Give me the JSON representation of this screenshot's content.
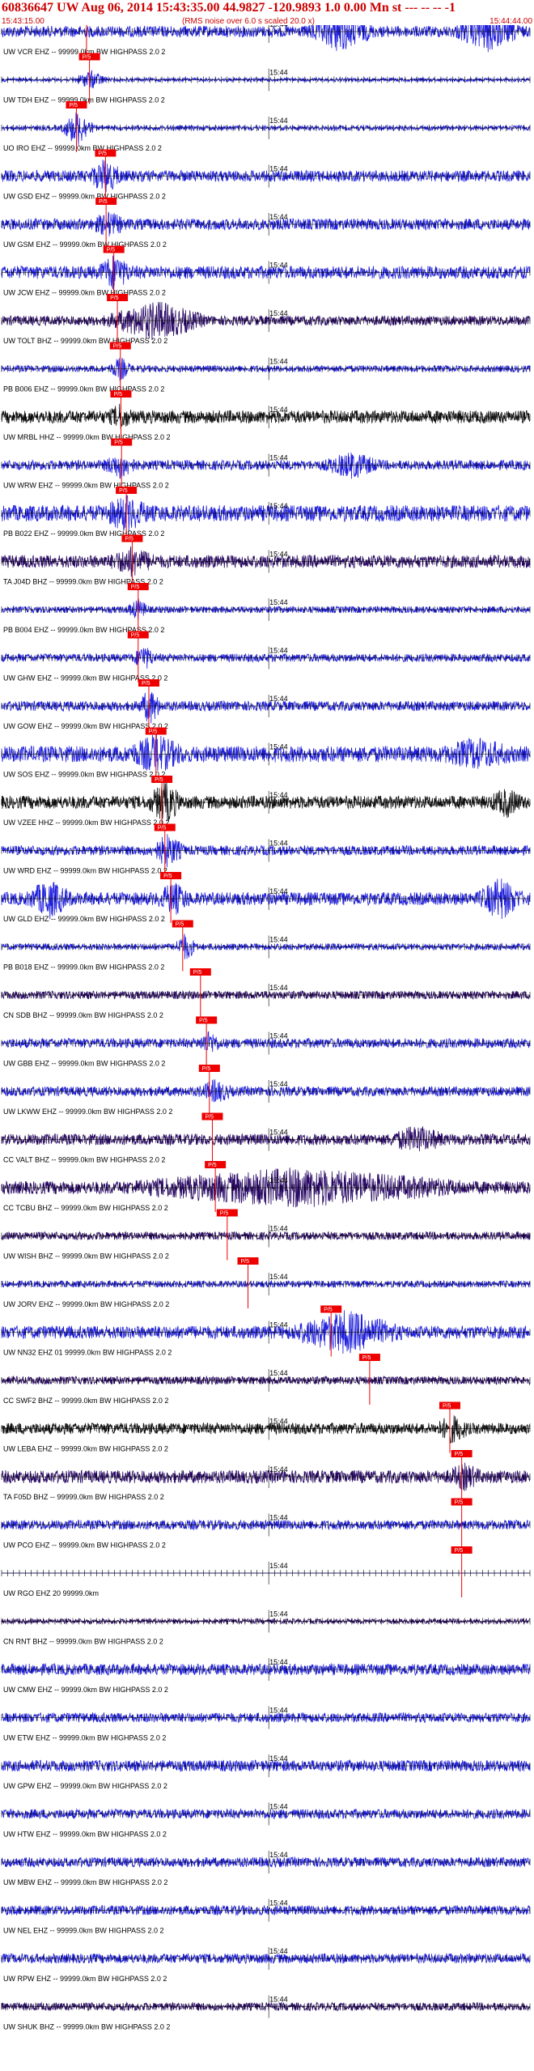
{
  "header": {
    "title": "60836647 UW Aug 06, 2014 15:43:35.00   44.9827 -120.9893  1.0 0.00 Mn st --- -- -- -1",
    "start_time": "15:43:15.00",
    "rms_note": "(RMS noise over 6.0 s scaled 20.0 x)",
    "end_time": "15:44:44.00"
  },
  "chart_data": {
    "type": "line",
    "title": "",
    "x_start": "15:43:15.00",
    "x_end": "15:44:44.00",
    "duration_s": 89,
    "tick_interval_s": 1,
    "minute_marker": "15:44",
    "minute_marker_time_s": 45,
    "colors": {
      "blue": "#1f1fdd",
      "black": "#111111",
      "purple": "#2a0a66",
      "pick": "#ee0000",
      "tick": "#000000"
    },
    "pick_label": "P/5",
    "traces": [
      {
        "label": "UW VCR EHZ -- 99999.0km BW  HIGHPASS  2.0  2",
        "color": "blue",
        "amp": 0.35,
        "pick_s": 14.3,
        "bursts": [
          [
            57,
            6,
            1.0
          ],
          [
            82,
            6,
            1.0
          ]
        ]
      },
      {
        "label": "UW TDH EHZ -- 99999.0km BW  HIGHPASS  2.0  2",
        "color": "blue",
        "amp": 0.12,
        "pick_s": 14.8,
        "bursts": [
          [
            15,
            3,
            0.5
          ]
        ]
      },
      {
        "label": "UO IRO EHZ -- 99999.0km BW  HIGHPASS  2.0  2",
        "color": "blue",
        "amp": 0.15,
        "pick_s": 12.6,
        "bursts": [
          [
            12.8,
            3,
            1.0
          ]
        ]
      },
      {
        "label": "UW GSD EHZ -- 99999.0km BW  HIGHPASS  2.0  2",
        "color": "blue",
        "amp": 0.35,
        "pick_s": 17.5,
        "bursts": [
          [
            17.5,
            3,
            0.8
          ]
        ]
      },
      {
        "label": "UW GSM EHZ -- 99999.0km BW  HIGHPASS  2.0  2",
        "color": "blue",
        "amp": 0.35,
        "pick_s": 17.6,
        "bursts": [
          [
            18,
            3,
            0.5
          ]
        ]
      },
      {
        "label": "UW JCW EHZ -- 99999.0km BW  HIGHPASS  2.0  2",
        "color": "blue",
        "amp": 0.4,
        "pick_s": 18.9,
        "bursts": [
          [
            19,
            3,
            0.8
          ]
        ]
      },
      {
        "label": "UW TOLT BHZ -- 99999.0km BW  HIGHPASS  2.0  2",
        "color": "purple",
        "amp": 0.3,
        "pick_s": 19.5,
        "bursts": [
          [
            26,
            9,
            1.0
          ]
        ]
      },
      {
        "label": "PB B006 EHZ -- 99999.0km BW  HIGHPASS  2.0  2",
        "color": "blue",
        "amp": 0.2,
        "pick_s": 20.0,
        "bursts": [
          [
            20,
            2,
            0.6
          ]
        ]
      },
      {
        "label": "UW MRBL HHZ -- 99999.0km BW  HIGHPASS  2.0  2",
        "color": "black",
        "amp": 0.4,
        "pick_s": 20.1,
        "bursts": [
          [
            20,
            2,
            0.5
          ]
        ]
      },
      {
        "label": "UW WRW EHZ -- 99999.0km BW  HIGHPASS  2.0  2",
        "color": "blue",
        "amp": 0.3,
        "pick_s": 20.2,
        "bursts": [
          [
            20,
            3,
            0.6
          ],
          [
            59,
            5,
            0.6
          ]
        ]
      },
      {
        "label": "PB B022 EHZ -- 99999.0km BW  HIGHPASS  2.0  2",
        "color": "blue",
        "amp": 0.5,
        "pick_s": 21.0,
        "bursts": [
          [
            21,
            4,
            0.7
          ]
        ]
      },
      {
        "label": "TA J04D BHZ -- 99999.0km BW  HIGHPASS  2.0  2",
        "color": "purple",
        "amp": 0.4,
        "pick_s": 22.0,
        "bursts": [
          [
            22,
            4,
            0.6
          ]
        ]
      },
      {
        "label": "PB B004 EHZ -- 99999.0km BW  HIGHPASS  2.0  2",
        "color": "blue",
        "amp": 0.2,
        "pick_s": 23.0,
        "bursts": [
          [
            23,
            2,
            0.5
          ]
        ]
      },
      {
        "label": "UW GHW EHZ -- 99999.0km BW  HIGHPASS  2.0  2",
        "color": "blue",
        "amp": 0.25,
        "pick_s": 23.0,
        "bursts": [
          [
            24,
            2,
            0.6
          ]
        ]
      },
      {
        "label": "UW GOW EHZ -- 99999.0km BW  HIGHPASS  2.0  2",
        "color": "blue",
        "amp": 0.3,
        "pick_s": 24.8,
        "bursts": [
          [
            25,
            2,
            0.9
          ]
        ]
      },
      {
        "label": "UW SOS EHZ -- 99999.0km BW  HIGHPASS  2.0  2",
        "color": "blue",
        "amp": 0.5,
        "pick_s": 26.0,
        "bursts": [
          [
            26,
            5,
            0.8
          ],
          [
            80,
            6,
            0.6
          ]
        ]
      },
      {
        "label": "UW VZEE HHZ -- 99999.0km BW  HIGHPASS  2.0  2",
        "color": "black",
        "amp": 0.4,
        "pick_s": 27.0,
        "bursts": [
          [
            27.5,
            3,
            1.0
          ],
          [
            85,
            3,
            0.6
          ]
        ]
      },
      {
        "label": "UW WRD EHZ -- 99999.0km BW  HIGHPASS  2.0  2",
        "color": "blue",
        "amp": 0.3,
        "pick_s": 27.5,
        "bursts": [
          [
            28,
            3,
            0.8
          ]
        ]
      },
      {
        "label": "UW GLD EHZ -- 99999.0km BW  HIGHPASS  2.0  2",
        "color": "blue",
        "amp": 0.4,
        "pick_s": 28.5,
        "bursts": [
          [
            8,
            4,
            0.9
          ],
          [
            29,
            3,
            0.7
          ],
          [
            84,
            4,
            1.0
          ]
        ]
      },
      {
        "label": "PB B018 EHZ -- 99999.0km BW  HIGHPASS  2.0  2",
        "color": "blue",
        "amp": 0.2,
        "pick_s": 30.5,
        "bursts": [
          [
            31,
            2,
            0.7
          ]
        ]
      },
      {
        "label": "CN SDB BHZ -- 99999.0km BW  HIGHPASS  2.0  2",
        "color": "purple",
        "amp": 0.25,
        "pick_s": 33.5,
        "bursts": []
      },
      {
        "label": "UW GBB EHZ -- 99999.0km BW  HIGHPASS  2.0  2",
        "color": "blue",
        "amp": 0.3,
        "pick_s": 34.5,
        "bursts": [
          [
            35,
            2,
            0.5
          ]
        ]
      },
      {
        "label": "UW LKWW EHZ -- 99999.0km BW  HIGHPASS  2.0  2",
        "color": "blue",
        "amp": 0.3,
        "pick_s": 35.0,
        "bursts": [
          [
            36,
            3,
            0.5
          ]
        ]
      },
      {
        "label": "CC VALT BHZ -- 99999.0km BW  HIGHPASS  2.0  2",
        "color": "purple",
        "amp": 0.35,
        "pick_s": 35.5,
        "bursts": [
          [
            70,
            5,
            0.6
          ]
        ]
      },
      {
        "label": "CC TCBU BHZ -- 99999.0km BW  HIGHPASS  2.0  2",
        "color": "purple",
        "amp": 0.4,
        "pick_s": 36.0,
        "bursts": [
          [
            50,
            30,
            0.9
          ]
        ]
      },
      {
        "label": "UW WISH BHZ -- 99999.0km BW  HIGHPASS  2.0  2",
        "color": "purple",
        "amp": 0.25,
        "pick_s": 38.0,
        "bursts": []
      },
      {
        "label": "UW JORV EHZ -- 99999.0km BW  HIGHPASS  2.0  2",
        "color": "blue",
        "amp": 0.2,
        "pick_s": 41.5,
        "bursts": []
      },
      {
        "label": "UW NN32 EHZ 01 99999.0km BW  HIGHPASS  2.0  2",
        "color": "blue",
        "amp": 0.4,
        "pick_s": 55.5,
        "bursts": [
          [
            58,
            10,
            1.0
          ]
        ]
      },
      {
        "label": "CC SWF2 BHZ -- 99999.0km BW  HIGHPASS  2.0  2",
        "color": "purple",
        "amp": 0.25,
        "pick_s": 62.0,
        "bursts": []
      },
      {
        "label": "UW LEBA EHZ -- 99999.0km BW  HIGHPASS  2.0  2",
        "color": "black",
        "amp": 0.35,
        "pick_s": 75.5,
        "bursts": [
          [
            76,
            3,
            0.6
          ]
        ]
      },
      {
        "label": "TA F05D BHZ -- 99999.0km BW  HIGHPASS  2.0  2",
        "color": "purple",
        "amp": 0.4,
        "pick_s": 77.5,
        "bursts": [
          [
            78,
            3,
            0.5
          ]
        ]
      },
      {
        "label": "UW PCO EHZ -- 99999.0km BW  HIGHPASS  2.0  2",
        "color": "blue",
        "amp": 0.3,
        "pick_s": 77.5,
        "bursts": []
      },
      {
        "label": "UW RGO EHZ 20 99999.0km",
        "color": "blue",
        "amp": 0.0,
        "pick_s": 77.5,
        "bursts": []
      },
      {
        "label": "CN RNT BHZ -- 99999.0km BW  HIGHPASS  2.0  2",
        "color": "purple",
        "amp": 0.15,
        "pick_s": null,
        "bursts": []
      },
      {
        "label": "UW CMW EHZ -- 99999.0km BW  HIGHPASS  2.0  2",
        "color": "blue",
        "amp": 0.35,
        "pick_s": null,
        "bursts": []
      },
      {
        "label": "UW ETW EHZ -- 99999.0km BW  HIGHPASS  2.0  2",
        "color": "blue",
        "amp": 0.3,
        "pick_s": null,
        "bursts": []
      },
      {
        "label": "UW GPW EHZ -- 99999.0km BW  HIGHPASS  2.0  2",
        "color": "blue",
        "amp": 0.35,
        "pick_s": null,
        "bursts": []
      },
      {
        "label": "UW HTW EHZ -- 99999.0km BW  HIGHPASS  2.0  2",
        "color": "blue",
        "amp": 0.3,
        "pick_s": null,
        "bursts": []
      },
      {
        "label": "UW MBW EHZ -- 99999.0km BW  HIGHPASS  2.0  2",
        "color": "blue",
        "amp": 0.3,
        "pick_s": null,
        "bursts": []
      },
      {
        "label": "UW NEL EHZ -- 99999.0km BW  HIGHPASS  2.0  2",
        "color": "blue",
        "amp": 0.3,
        "pick_s": null,
        "bursts": []
      },
      {
        "label": "UW RPW EHZ -- 99999.0km BW  HIGHPASS  2.0  2",
        "color": "blue",
        "amp": 0.3,
        "pick_s": null,
        "bursts": []
      },
      {
        "label": "UW SHUK BHZ -- 99999.0km BW  HIGHPASS  2.0  2",
        "color": "purple",
        "amp": 0.25,
        "pick_s": null,
        "bursts": []
      }
    ]
  }
}
